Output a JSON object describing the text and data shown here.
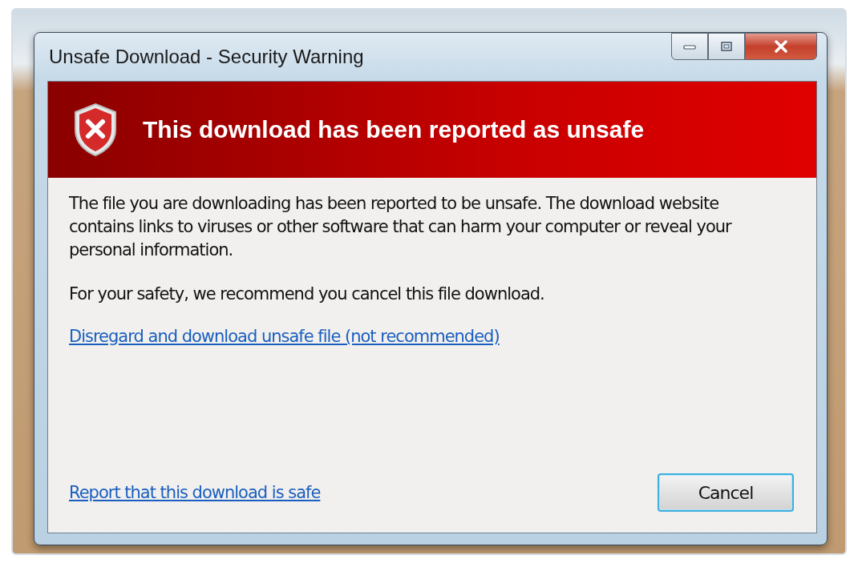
{
  "window": {
    "title": "Unsafe Download - Security Warning"
  },
  "banner": {
    "heading": "This download has been reported as unsafe"
  },
  "message": {
    "paragraphs": [
      "The file you are downloading has been reported to be unsafe. The download website contains links to viruses or other software that can harm your computer or reveal your personal information.",
      "For your safety, we recommend you cancel this file download."
    ]
  },
  "links": {
    "disregard": "Disregard and download unsafe file (not recommended)",
    "report": "Report that this download is safe"
  },
  "buttons": [
    {
      "label": "Cancel",
      "focused": true
    }
  ]
}
